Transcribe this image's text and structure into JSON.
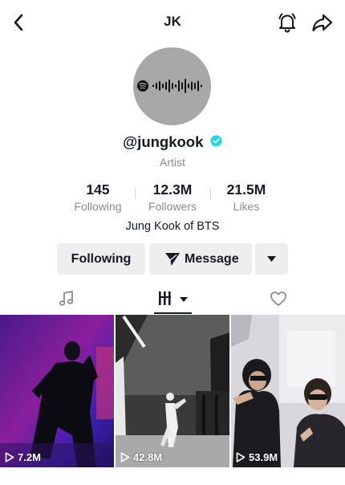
{
  "header": {
    "title": "JK"
  },
  "profile": {
    "handle": "@jungkook",
    "role": "Artist",
    "bio": "Jung Kook of BTS"
  },
  "stats": [
    {
      "value": "145",
      "label": "Following"
    },
    {
      "value": "12.3M",
      "label": "Followers"
    },
    {
      "value": "21.5M",
      "label": "Likes"
    }
  ],
  "actions": {
    "following_label": "Following",
    "message_label": "Message"
  },
  "videos": [
    {
      "views": "7.2M"
    },
    {
      "views": "42.8M"
    },
    {
      "views": "53.9M"
    }
  ],
  "colors": {
    "verified": "#20d5ec",
    "text": "#161823",
    "secondary": "#8a8b91",
    "button_bg": "#eeeeef"
  }
}
